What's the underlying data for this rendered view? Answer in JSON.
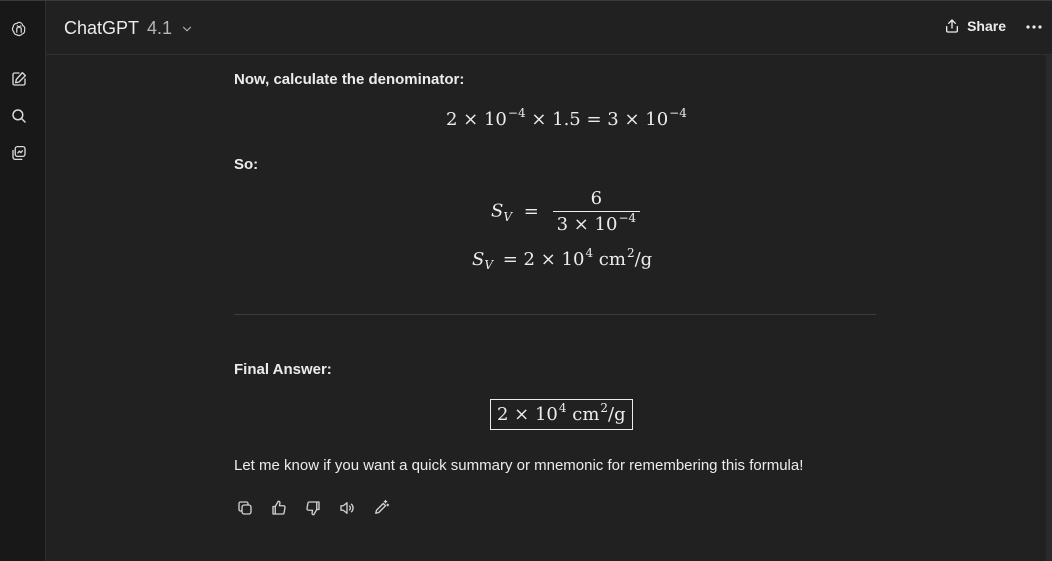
{
  "header": {
    "model_name": "ChatGPT",
    "model_version": "4.1",
    "share_label": "Share"
  },
  "sidebar": {
    "icons": [
      "openai-logo-icon",
      "new-chat-icon",
      "search-icon",
      "library-icon"
    ]
  },
  "message": {
    "intro_text": "Now, calculate the denominator:",
    "eq1": {
      "a": "2 × 10",
      "a_exp": "−4",
      "b": " × 1.5 = 3 × 10",
      "b_exp": "−4"
    },
    "so_text": "So:",
    "eq2": {
      "lhs_var": "S",
      "lhs_sub": "V",
      "equals": "=",
      "numerator": "6",
      "denominator": "3 × 10",
      "denominator_exp": "−4"
    },
    "eq3": {
      "lhs_var": "S",
      "lhs_sub": "V",
      "rhs": "= 2 × 10",
      "rhs_exp": "4",
      "unit": " cm",
      "unit_exp": "2",
      "unit_tail": "/g"
    },
    "final_label": "Final Answer:",
    "final_box": {
      "value": "2 × 10",
      "value_exp": "4",
      "unit": " cm",
      "unit_exp": "2",
      "unit_tail": "/g"
    },
    "closing_text": "Let me know if you want a quick summary or mnemonic for remembering this formula!"
  },
  "actions": [
    "copy-icon",
    "thumbs-up-icon",
    "thumbs-down-icon",
    "read-aloud-icon",
    "edit-icon"
  ]
}
